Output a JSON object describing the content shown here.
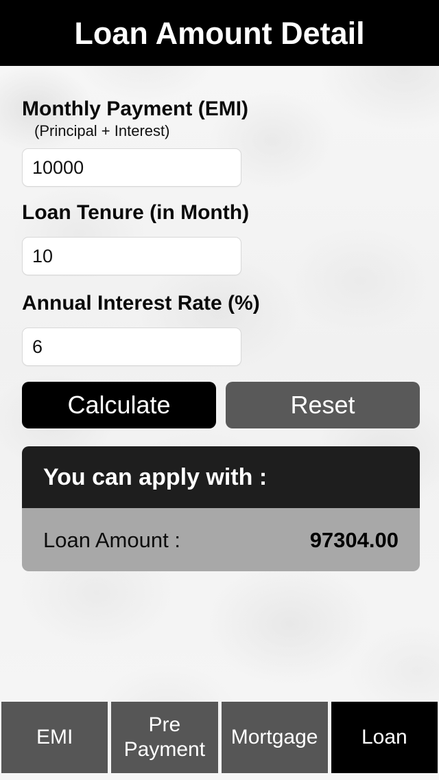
{
  "header": {
    "title": "Loan Amount Detail",
    "background_color": "#000000",
    "text_color": "#ffffff"
  },
  "form": {
    "fields": [
      {
        "label": "Monthly Payment (EMI)",
        "sublabel": "(Principal + Interest)",
        "value": "10000",
        "placeholder": ""
      },
      {
        "label": "Loan Tenure (in Month)",
        "sublabel": "",
        "value": "10",
        "placeholder": ""
      },
      {
        "label": "Annual Interest Rate (%)",
        "sublabel": "",
        "value": "6",
        "placeholder": ""
      }
    ]
  },
  "actions": {
    "calculate_label": "Calculate",
    "calculate_color": "#000000",
    "reset_label": "Reset",
    "reset_color": "#595959"
  },
  "result": {
    "heading": "You can apply with :",
    "heading_background": "#1e1e1e",
    "row_background": "#a8a8a8",
    "rows": [
      {
        "key": "Loan Amount :",
        "value": "97304.00"
      }
    ]
  },
  "tabs": {
    "items": [
      {
        "label": "EMI",
        "active": false
      },
      {
        "label": "Pre\nPayment",
        "active": false
      },
      {
        "label": "Mortgage",
        "active": false
      },
      {
        "label": "Loan",
        "active": true
      }
    ],
    "inactive_color": "#565656",
    "active_color": "#000000"
  }
}
